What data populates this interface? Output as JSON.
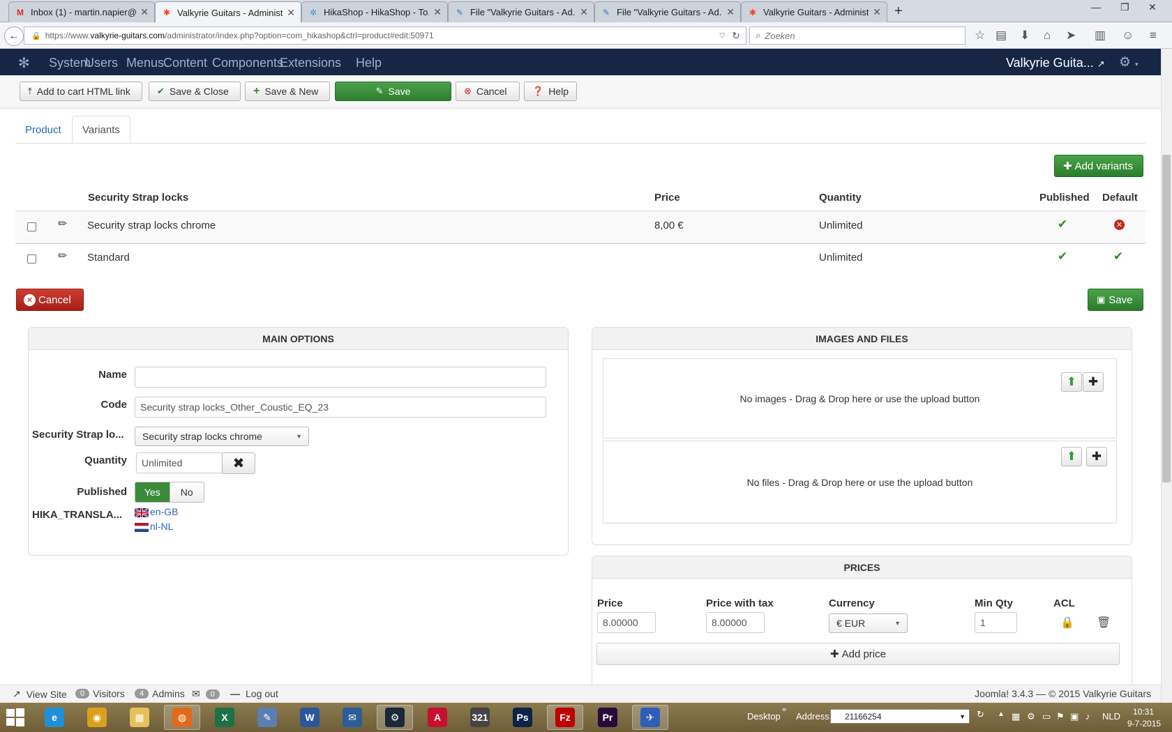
{
  "browser": {
    "tabs": [
      {
        "title": "Inbox (1) - martin.napier@...",
        "icon": "gmail-icon",
        "favicon": "M",
        "color": "#d93025"
      },
      {
        "title": "Valkyrie Guitars - Administ...",
        "icon": "joomla-icon",
        "favicon": "✱",
        "color": "#f44321",
        "active": true
      },
      {
        "title": "HikaShop - HikaShop - To...",
        "icon": "hikashop-icon",
        "favicon": "✲",
        "color": "#2c8fd6"
      },
      {
        "title": "File \"Valkyrie Guitars - Ad...",
        "icon": "file-icon",
        "favicon": "✎",
        "color": "#3b6fc4"
      },
      {
        "title": "File \"Valkyrie Guitars - Ad...",
        "icon": "file-icon",
        "favicon": "✎",
        "color": "#3b6fc4"
      },
      {
        "title": "Valkyrie Guitars - Administ...",
        "icon": "joomla-icon",
        "favicon": "✱",
        "color": "#f44321"
      }
    ],
    "url_prefix": "https://www.",
    "url_domain": "valkyrie-guitars.com",
    "url_path": "/administrator/index.php?option=com_hikashop&ctrl=product#edit:50971",
    "search_placeholder": "Zoeken"
  },
  "joomla": {
    "menu": [
      "System",
      "Users",
      "Menus",
      "Content",
      "Components",
      "Extensions",
      "Help"
    ],
    "site_name": "Valkyrie Guita..."
  },
  "toolbar": {
    "add_to_cart": "Add to cart HTML link",
    "save_close": "Save & Close",
    "save_new": "Save & New",
    "save": "Save",
    "cancel": "Cancel",
    "help": "Help"
  },
  "tabs": {
    "product": "Product",
    "variants": "Variants"
  },
  "variants": {
    "add_button": "Add variants",
    "headers": {
      "name": "Security Strap locks",
      "price": "Price",
      "quantity": "Quantity",
      "published": "Published",
      "default": "Default"
    },
    "rows": [
      {
        "name": "Security strap locks chrome",
        "price": "8,00 €",
        "quantity": "Unlimited",
        "published": true,
        "default": false
      },
      {
        "name": "Standard",
        "price": "",
        "quantity": "Unlimited",
        "published": true,
        "default": true
      }
    ],
    "cancel": "Cancel",
    "save": "Save"
  },
  "main_options": {
    "title": "MAIN OPTIONS",
    "name_label": "Name",
    "name_value": "",
    "code_label": "Code",
    "code_value": "Security strap locks_Other_Coustic_EQ_23",
    "strap_label": "Security Strap lo...",
    "strap_value": "Security strap locks chrome",
    "quantity_label": "Quantity",
    "quantity_value": "Unlimited",
    "published_label": "Published",
    "published_yes": "Yes",
    "published_no": "No",
    "translation_label": "HIKA_TRANSLA...",
    "lang_en": "en-GB",
    "lang_nl": "nl-NL"
  },
  "images": {
    "title": "IMAGES AND FILES",
    "no_images": "No images - Drag & Drop here or use the upload button",
    "no_files": "No files - Drag & Drop here or use the upload button"
  },
  "prices": {
    "title": "PRICES",
    "headers": {
      "price": "Price",
      "price_tax": "Price with tax",
      "currency": "Currency",
      "min_qty": "Min Qty",
      "acl": "ACL"
    },
    "price": "8.00000",
    "price_tax": "8.00000",
    "currency": "€ EUR",
    "min_qty": "1",
    "add_price": "Add price"
  },
  "footer": {
    "view_site": "View Site",
    "visitors_count": "0",
    "visitors": "Visitors",
    "admins_count": "4",
    "admins": "Admins",
    "messages_count": "0",
    "logout": "Log out",
    "version": "Joomla! 3.4.3  —  © 2015 Valkyrie Guitars"
  },
  "taskbar": {
    "apps": [
      {
        "name": "internet-explorer-icon",
        "glyph": "e",
        "color": "#1e90d8"
      },
      {
        "name": "chrome-icon",
        "glyph": "◉",
        "color": "#d8a01c"
      },
      {
        "name": "file-explorer-icon",
        "glyph": "▦",
        "color": "#e6c15a"
      },
      {
        "name": "firefox-icon",
        "glyph": "◍",
        "color": "#e06a1a",
        "active": true
      },
      {
        "name": "excel-icon",
        "glyph": "X",
        "color": "#1e7145"
      },
      {
        "name": "notepad-icon",
        "glyph": "✎",
        "color": "#5a7fb3"
      },
      {
        "name": "word-icon",
        "glyph": "W",
        "color": "#2b579a"
      },
      {
        "name": "thunderbird-icon",
        "glyph": "✉",
        "color": "#2a5d9a"
      },
      {
        "name": "steam-icon",
        "glyph": "⚙",
        "color": "#1b2838",
        "active": true
      },
      {
        "name": "acrobat-icon",
        "glyph": "A",
        "color": "#c8102e"
      },
      {
        "name": "media-player-icon",
        "glyph": "321",
        "color": "#444"
      },
      {
        "name": "photoshop-icon",
        "glyph": "Ps",
        "color": "#0b2447"
      },
      {
        "name": "filezilla-icon",
        "glyph": "Fz",
        "color": "#bf0000",
        "active": true
      },
      {
        "name": "premiere-icon",
        "glyph": "Pr",
        "color": "#2a0a3d"
      },
      {
        "name": "app-icon",
        "glyph": "✈",
        "color": "#2d5fb8",
        "active": true
      }
    ],
    "desktop": "Desktop",
    "address_label": "Address",
    "address_value": "21166254",
    "lang": "NLD",
    "time": "10:31",
    "date": "9-7-2015"
  }
}
